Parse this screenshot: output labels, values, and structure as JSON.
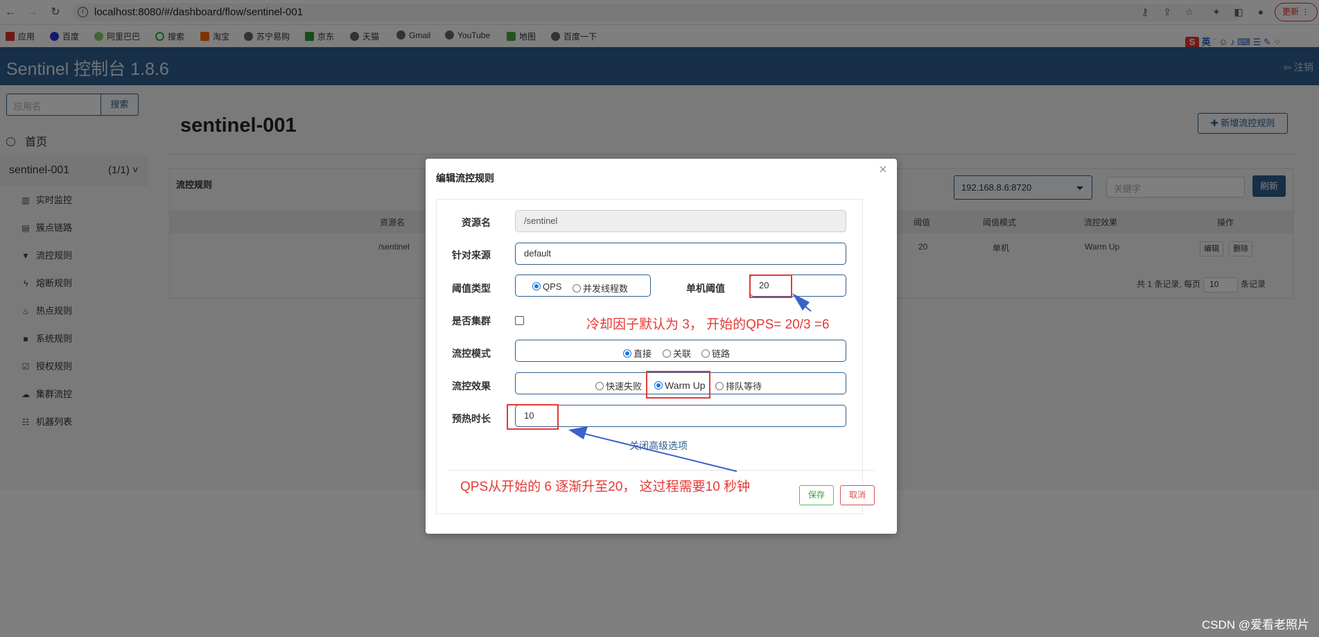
{
  "browser": {
    "url": "localhost:8080/#/dashboard/flow/sentinel-001",
    "update_label": "更新",
    "bookmarks": [
      "应用",
      "百度",
      "阿里巴巴",
      "搜索",
      "淘宝",
      "苏宁易购",
      "京东",
      "天猫",
      "Gmail",
      "YouTube",
      "地图",
      "百度一下"
    ],
    "ime_label": "英"
  },
  "header": {
    "brand": "Sentinel 控制台 1.8.6",
    "logout": "注销"
  },
  "sidebar": {
    "search_placeholder": "应用名",
    "search_button": "搜索",
    "home": "首页",
    "app_name": "sentinel-001",
    "app_count": "(1/1)",
    "menu": [
      "实时监控",
      "簇点链路",
      "流控规则",
      "熔断规则",
      "热点规则",
      "系统规则",
      "授权规则",
      "集群流控",
      "机器列表"
    ]
  },
  "main": {
    "title": "sentinel-001",
    "add_rule": "新增流控规则",
    "panel_title": "流控规则",
    "machine_select": "192.168.8.6:8720",
    "keyword_placeholder": "关键字",
    "refresh": "刷新",
    "columns": [
      "资源名",
      "阈值",
      "阈值模式",
      "流控效果",
      "操作"
    ],
    "row": {
      "resource": "/sentinel",
      "threshold": "20",
      "mode": "单机",
      "effect": "Warm Up",
      "edit": "编辑",
      "delete": "删除"
    },
    "pager": {
      "prefix": "共 1 条记录, 每页",
      "size": "10",
      "suffix": "条记录"
    }
  },
  "modal": {
    "title": "编辑流控规则",
    "close": "×",
    "labels": {
      "resource": "资源名",
      "limit_app": "针对来源",
      "grade": "阈值类型",
      "count": "单机阈值",
      "cluster": "是否集群",
      "strategy": "流控模式",
      "behavior": "流控效果",
      "warmup": "预热时长"
    },
    "values": {
      "resource": "/sentinel",
      "limit_app": "default",
      "count": "20",
      "warmup": "10"
    },
    "grade_options": [
      "QPS",
      "并发线程数"
    ],
    "strategy_options": [
      "直接",
      "关联",
      "链路"
    ],
    "behavior_options": [
      "快速失败",
      "Warm Up",
      "排队等待"
    ],
    "advanced_link": "关闭高级选项",
    "save": "保存",
    "cancel": "取消"
  },
  "annotations": {
    "note1": "冷却因子默认为 3， 开始的QPS= 20/3 =6",
    "note2": "QPS从开始的 6 逐渐升至20， 这过程需要10 秒钟",
    "color": "#e53935",
    "arrow_color": "#3a63c8"
  },
  "watermark": "CSDN @爱看老照片"
}
